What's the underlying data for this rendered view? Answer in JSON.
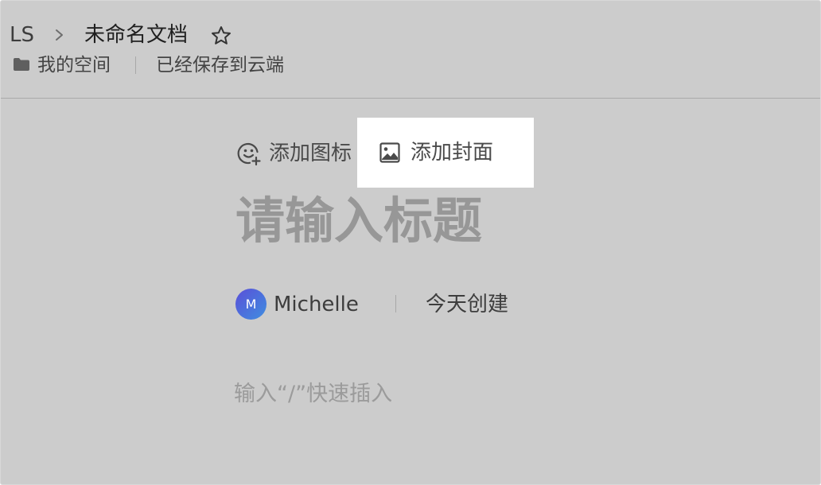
{
  "breadcrumb": {
    "root": "LS",
    "separator_icon": "chevron-right-icon",
    "document_title": "未命名文档",
    "favorite_icon": "star-icon"
  },
  "location": {
    "folder_icon": "folder-icon",
    "space": "我的空间",
    "save_status": "已经保存到云端"
  },
  "toolbar": {
    "add_icon_label": "添加图标",
    "add_cover_label": "添加封面"
  },
  "document": {
    "title_placeholder": "请输入标题",
    "author_initial": "M",
    "author_name": "Michelle",
    "created": "今天创建",
    "body_placeholder": "输入“/”快速插入"
  },
  "colors": {
    "overlay": "#cccccc",
    "highlight": "#ffffff",
    "avatar_start": "#5a4fd8",
    "avatar_end": "#3f8ee0"
  }
}
